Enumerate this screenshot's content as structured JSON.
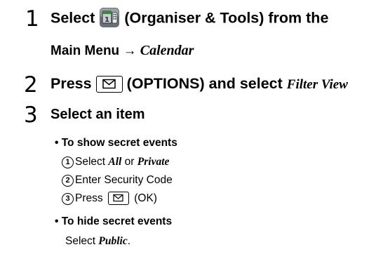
{
  "steps": [
    {
      "number": "1",
      "text_a": "Select",
      "text_b": "(Organiser & Tools) from the",
      "text_c": "Main Menu",
      "arrow": "→",
      "text_d": "Calendar",
      "icon": "organiser-tools-icon"
    },
    {
      "number": "2",
      "text_a": "Press",
      "text_b": "(OPTIONS) and select",
      "text_c": "Filter View",
      "icon": "envelope-key-icon"
    },
    {
      "number": "3",
      "text_a": "Select an item"
    }
  ],
  "show_secret": {
    "heading": "• To show secret events",
    "items": [
      {
        "marker": "1",
        "pre": "Select",
        "opt1": "All",
        "mid": "or",
        "opt2": "Private"
      },
      {
        "marker": "2",
        "text": "Enter Security Code"
      },
      {
        "marker": "3",
        "pre": "Press",
        "post": "(OK)"
      }
    ]
  },
  "hide_secret": {
    "heading": "• To hide secret events",
    "pre": "Select",
    "option": "Public",
    "end": "."
  },
  "colors": {
    "icon_dark": "#2b2f33",
    "icon_mid": "#6a7076",
    "icon_light": "#c8cdd2",
    "accent": "#3a8a3a"
  }
}
